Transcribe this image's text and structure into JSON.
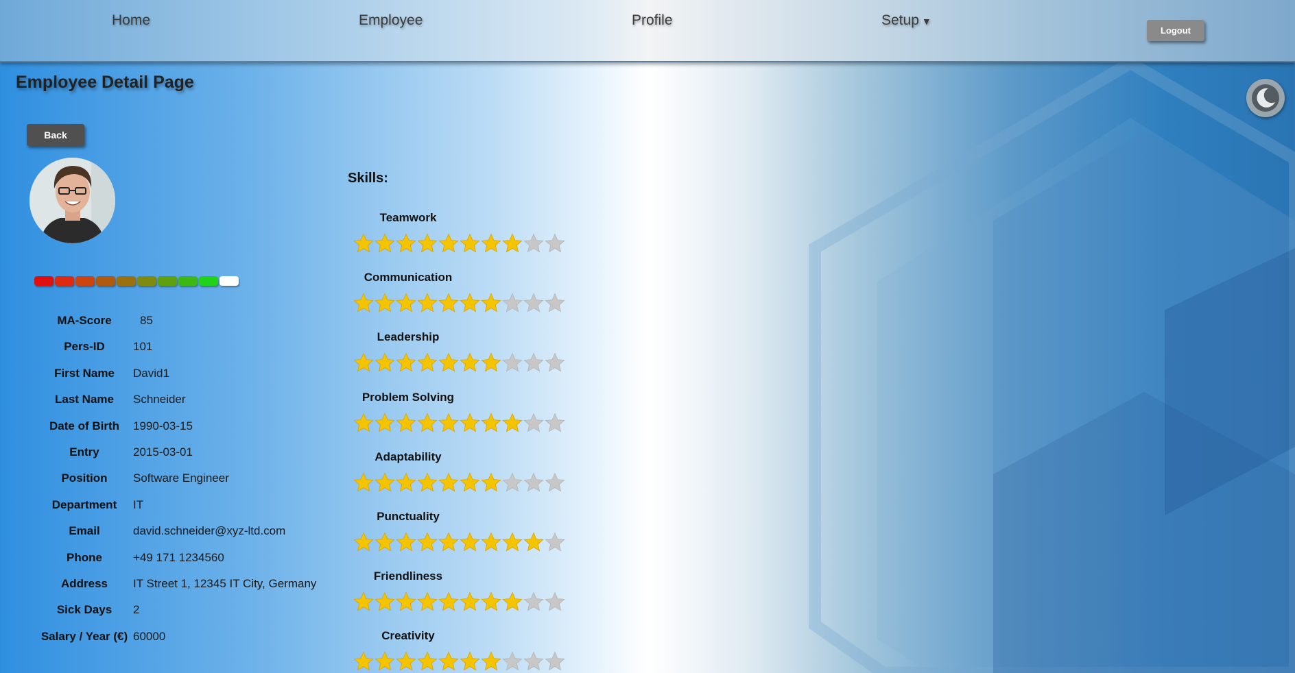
{
  "nav": {
    "home": "Home",
    "employee": "Employee",
    "profile": "Profile",
    "setup": "Setup",
    "logout": "Logout"
  },
  "page_title": "Employee Detail Page",
  "back_label": "Back",
  "score_bar": {
    "colors": [
      "#e01010",
      "#dd2a10",
      "#cc4410",
      "#b05a10",
      "#9a7010",
      "#7f8a10",
      "#5fa010",
      "#3cb814",
      "#22d11a",
      "#ffffff"
    ],
    "filled_segments": 9,
    "total_segments": 10
  },
  "employee": {
    "fields": [
      {
        "label": "MA-Score",
        "value": "85"
      },
      {
        "label": "Pers-ID",
        "value": "101"
      },
      {
        "label": "First Name",
        "value": "David1"
      },
      {
        "label": "Last Name",
        "value": "Schneider"
      },
      {
        "label": "Date of Birth",
        "value": "1990-03-15"
      },
      {
        "label": "Entry",
        "value": "2015-03-01"
      },
      {
        "label": "Position",
        "value": "Software Engineer"
      },
      {
        "label": "Department",
        "value": "IT"
      },
      {
        "label": "Email",
        "value": "david.schneider@xyz-ltd.com"
      },
      {
        "label": "Phone",
        "value": "+49 171 1234560"
      },
      {
        "label": "Address",
        "value": "IT Street 1, 12345 IT City, Germany"
      },
      {
        "label": "Sick Days",
        "value": "2"
      },
      {
        "label": "Salary / Year (€)",
        "value": "60000"
      }
    ]
  },
  "skills_title": "Skills:",
  "skills": [
    {
      "name": "Teamwork",
      "rating": 8,
      "max": 10
    },
    {
      "name": "Communication",
      "rating": 7,
      "max": 10
    },
    {
      "name": "Leadership",
      "rating": 7,
      "max": 10
    },
    {
      "name": "Problem Solving",
      "rating": 8,
      "max": 10
    },
    {
      "name": "Adaptability",
      "rating": 7,
      "max": 10
    },
    {
      "name": "Punctuality",
      "rating": 9,
      "max": 10
    },
    {
      "name": "Friendliness",
      "rating": 8,
      "max": 10
    },
    {
      "name": "Creativity",
      "rating": 7,
      "max": 10
    }
  ],
  "colors": {
    "star_filled": "#f5c400",
    "star_empty": "#c7c7c7"
  },
  "icons": {
    "theme_toggle": "moon-icon",
    "setup_caret": "caret-down-icon"
  }
}
